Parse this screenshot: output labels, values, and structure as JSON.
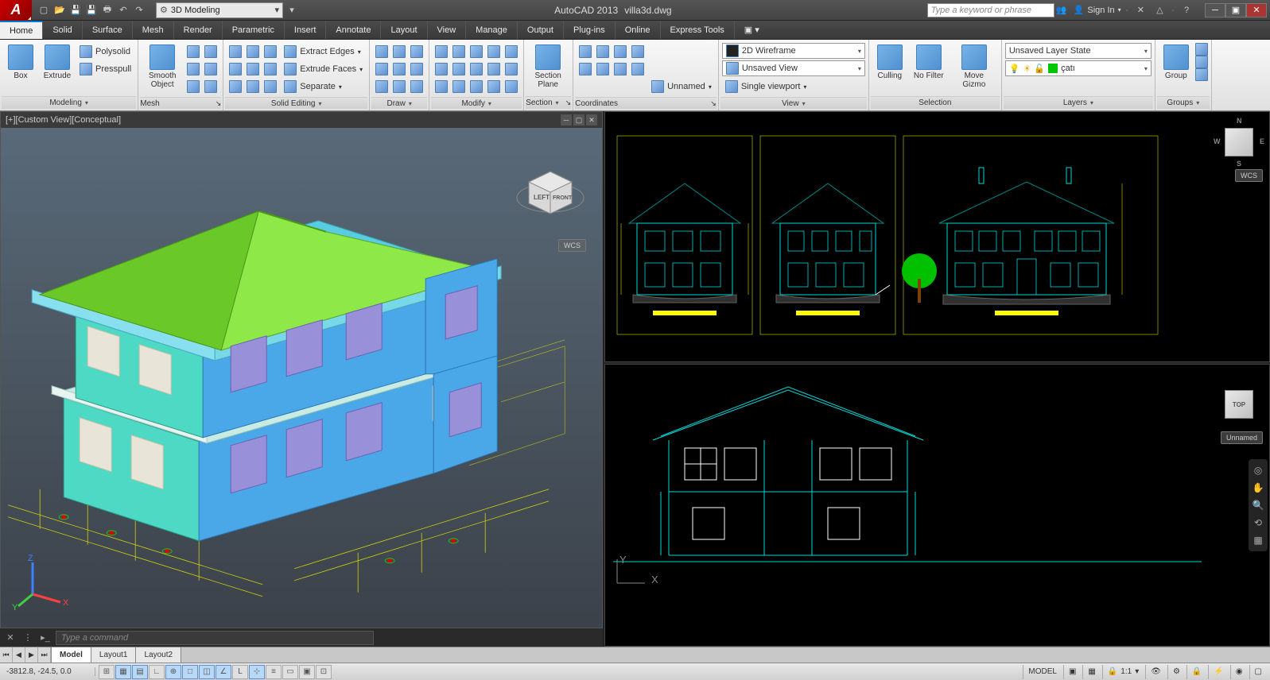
{
  "app": {
    "title": "AutoCAD 2013",
    "file": "villa3d.dwg",
    "logo": "A"
  },
  "qat": {
    "workspace": "3D Modeling"
  },
  "search": {
    "placeholder": "Type a keyword or phrase"
  },
  "signin": {
    "label": "Sign In"
  },
  "menu": {
    "tabs": [
      "Home",
      "Solid",
      "Surface",
      "Mesh",
      "Render",
      "Parametric",
      "Insert",
      "Annotate",
      "Layout",
      "View",
      "Manage",
      "Output",
      "Plug-ins",
      "Online",
      "Express Tools"
    ],
    "active": 0
  },
  "ribbon": {
    "modeling": {
      "label": "Modeling",
      "box": "Box",
      "extrude": "Extrude",
      "polysolid": "Polysolid",
      "presspull": "Presspull",
      "smooth": "Smooth Object"
    },
    "mesh": {
      "label": "Mesh"
    },
    "solidedit": {
      "label": "Solid Editing",
      "extract": "Extract Edges",
      "extrudef": "Extrude Faces",
      "separate": "Separate"
    },
    "draw": {
      "label": "Draw"
    },
    "modify": {
      "label": "Modify"
    },
    "section": {
      "label": "Section",
      "plane": "Section Plane"
    },
    "coordinates": {
      "label": "Coordinates",
      "unnamed": "Unnamed"
    },
    "view": {
      "label": "View",
      "style": "2D Wireframe",
      "saved": "Unsaved View",
      "viewport": "Single viewport"
    },
    "selection": {
      "label": "Selection",
      "culling": "Culling",
      "nofilter": "No Filter",
      "gizmo": "Move Gizmo"
    },
    "layers": {
      "label": "Layers",
      "state": "Unsaved Layer State",
      "current": "çatı"
    },
    "groups": {
      "label": "Groups",
      "group": "Group"
    }
  },
  "viewports": {
    "v3d": {
      "label": "[+][Custom View][Conceptual]",
      "cubeLeft": "LEFT",
      "cubeFront": "FRONT",
      "wcs": "WCS"
    },
    "v1": {
      "wcs": "WCS",
      "compass": {
        "n": "N",
        "s": "S",
        "e": "E",
        "w": "W"
      }
    },
    "v2": {
      "top": "TOP",
      "unnamed": "Unnamed",
      "axisY": "Y",
      "axisX": "X"
    }
  },
  "cmdline": {
    "prompt": "Type a command"
  },
  "layouts": {
    "tabs": [
      "Model",
      "Layout1",
      "Layout2"
    ],
    "active": 0
  },
  "statusbar": {
    "coords": "-3812.8, -24.5, 0.0",
    "model": "MODEL",
    "scale": "1:1"
  }
}
